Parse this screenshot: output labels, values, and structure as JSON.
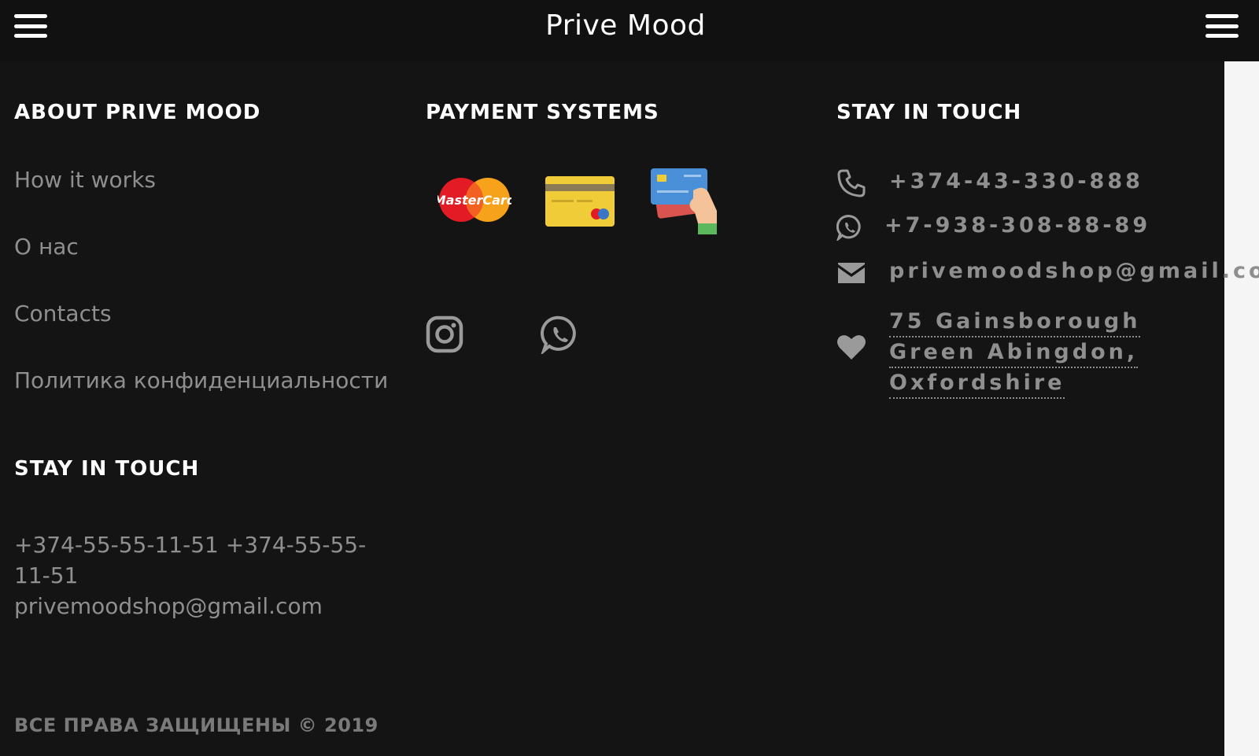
{
  "header": {
    "brand": "Prive Mood"
  },
  "about": {
    "title": "ABOUT PRIVE MOOD",
    "links": [
      "How it works",
      "О нас",
      "Contacts",
      "Политика конфиденциальности"
    ]
  },
  "payment": {
    "title": "PAYMENT SYSTEMS",
    "mastercard_text": "MasterCard"
  },
  "contacts": {
    "title": "STAY IN TOUCH",
    "phone": "+374-43-330-888",
    "whatsapp": "+7-938-308-88-89",
    "email": "privemoodshop@gmail.com",
    "address_lines": [
      "75 Gainsborough",
      "Green Abingdon,",
      "Oxfordshire"
    ]
  },
  "footer_contact": {
    "title": "STAY IN TOUCH",
    "phones": "+374-55-55-11-51 +374-55-55-11-51",
    "email": "privemoodshop@gmail.com"
  },
  "copyright": "ВСЕ ПРАВА ЗАЩИЩЕНЫ © 2019",
  "colors": {
    "background": "#141414",
    "header": "#111111",
    "muted_text": "#8f8f8f",
    "title_text": "#ffffff"
  }
}
